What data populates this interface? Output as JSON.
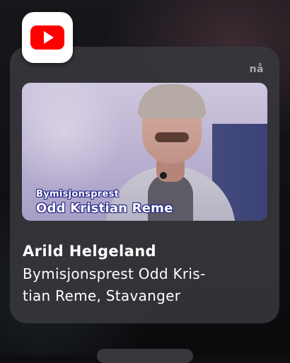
{
  "notification": {
    "app_icon": "youtube-icon",
    "time": "nå",
    "title": "Arild Helgeland",
    "body": "Bymisjonsprest Odd Kris-\ntian Reme, Stavanger",
    "thumbnail": {
      "caption_line1": "Bymisjonsprest",
      "caption_line2": "Odd Kristian Reme"
    }
  },
  "colors": {
    "card": "#38383e",
    "youtube_red": "#ff0000",
    "caption_outline": "#24248a"
  }
}
